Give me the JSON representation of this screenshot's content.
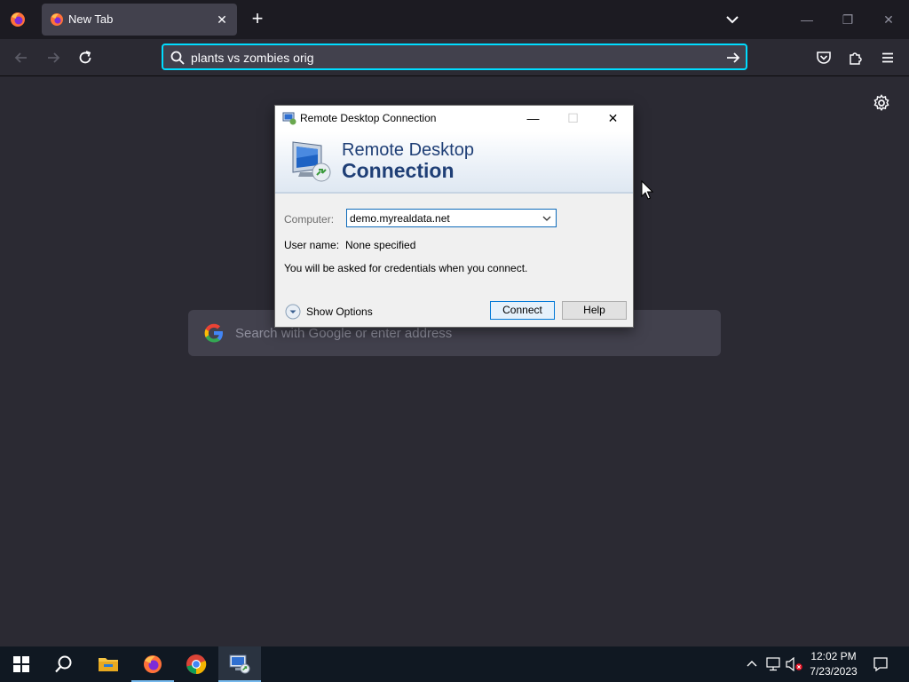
{
  "browser": {
    "tab": {
      "title": "New Tab",
      "close": "✕"
    },
    "newtab": "+",
    "urlbar": {
      "value": "plants vs zombies orig"
    },
    "window_controls": {
      "minimize": "—",
      "restore": "❐",
      "close": "✕"
    }
  },
  "newtab_page": {
    "search_placeholder": "Search with Google or enter address"
  },
  "rdc_dialog": {
    "title": "Remote Desktop Connection",
    "banner_line1": "Remote Desktop",
    "banner_line2": "Connection",
    "computer_label": "Computer:",
    "computer_value": "demo.myrealdata.net",
    "username_label": "User name:",
    "username_value": "None specified",
    "credentials_note": "You will be asked for credentials when you connect.",
    "show_options": "Show Options",
    "connect": "Connect",
    "help": "Help",
    "controls": {
      "minimize": "—",
      "maximize": "☐",
      "close": "✕"
    }
  },
  "taskbar": {
    "time": "12:02 PM",
    "date": "7/23/2023",
    "icons": [
      "windows-start-icon",
      "search-icon",
      "file-explorer-icon",
      "firefox-icon",
      "chrome-icon",
      "remote-desktop-icon"
    ]
  },
  "colors": {
    "browser_bg": "#2b2a33",
    "tabbar_bg": "#1c1b22",
    "accent": "#00ddff",
    "rdc_title_blue": "#1f3f76",
    "taskbar_bg": "#101822"
  }
}
